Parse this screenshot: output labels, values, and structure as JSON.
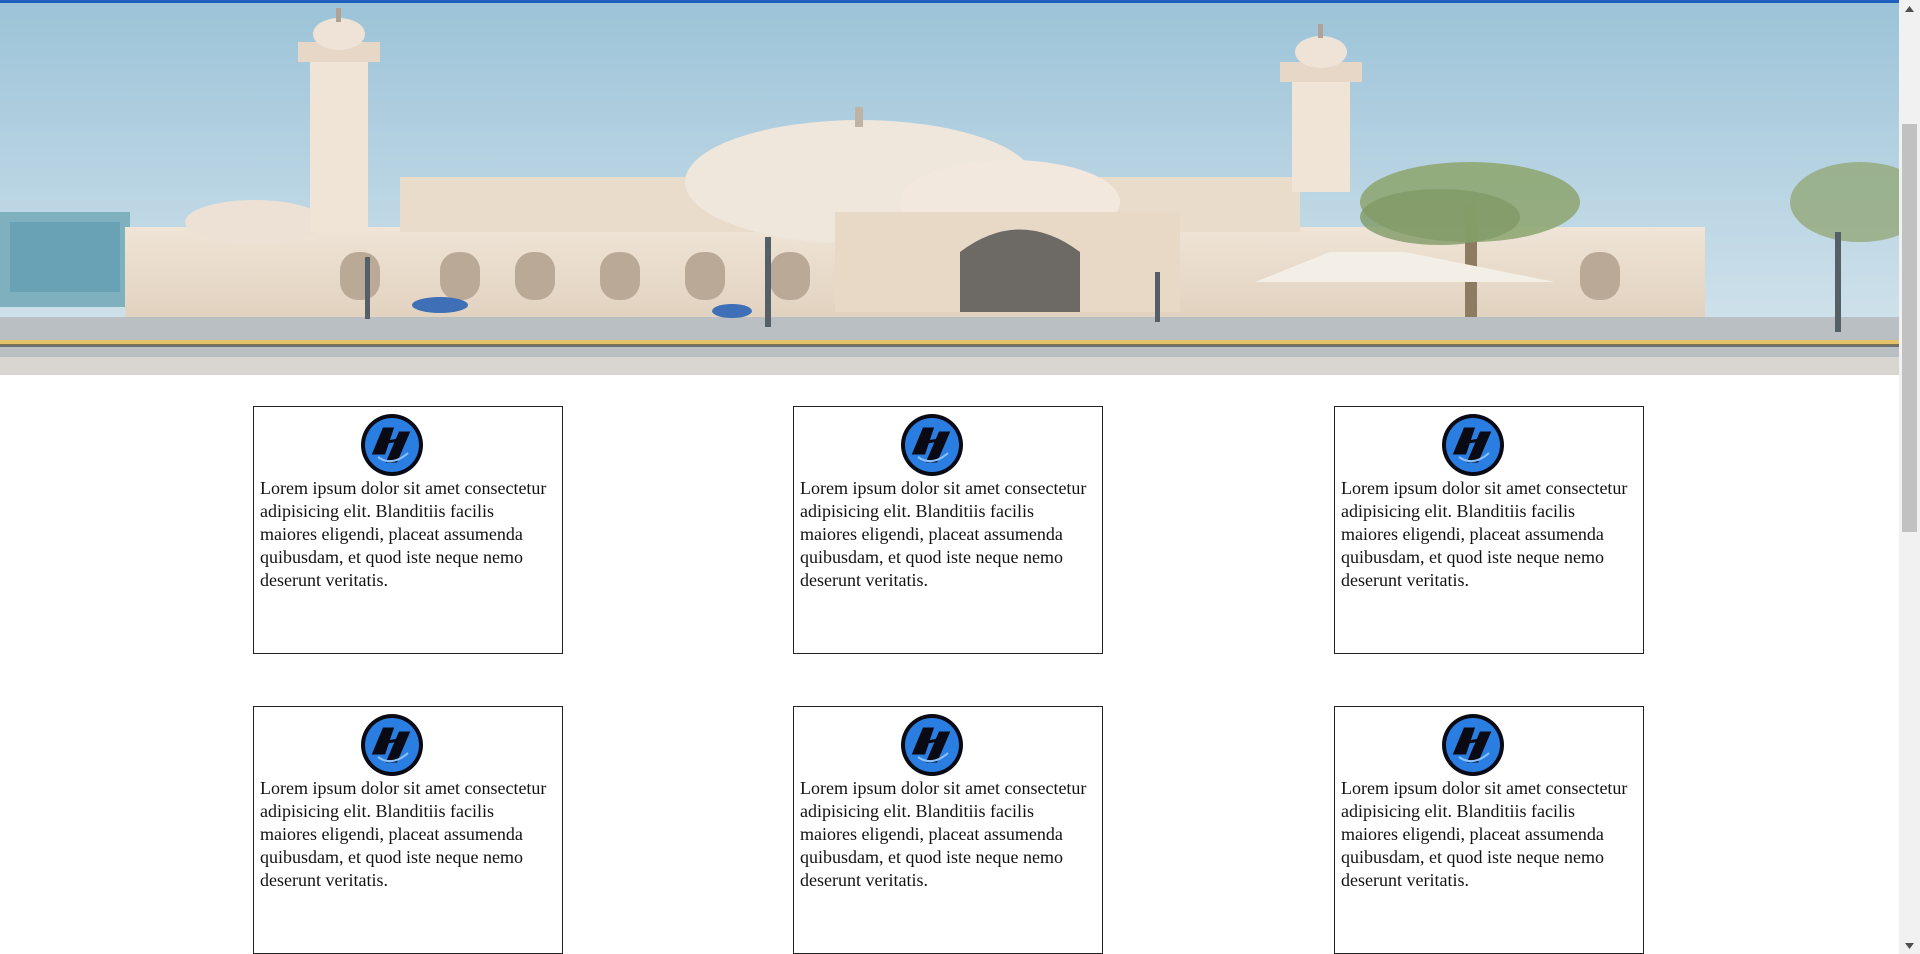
{
  "colors": {
    "top_accent": "#1f5fbf",
    "card_border": "#222222",
    "logo_blue": "#2a7de1",
    "logo_dark": "#0a0a14"
  },
  "hero": {
    "image": "mosque-photo",
    "description_icon": "banner-image"
  },
  "cards": [
    {
      "icon": "brand-logo-icon",
      "text": "Lorem ipsum dolor sit amet consectetur adipisicing elit. Blanditiis facilis maiores eligendi, placeat assumenda quibusdam, et quod iste neque nemo deserunt veritatis."
    },
    {
      "icon": "brand-logo-icon",
      "text": "Lorem ipsum dolor sit amet consectetur adipisicing elit. Blanditiis facilis maiores eligendi, placeat assumenda quibusdam, et quod iste neque nemo deserunt veritatis."
    },
    {
      "icon": "brand-logo-icon",
      "text": "Lorem ipsum dolor sit amet consectetur adipisicing elit. Blanditiis facilis maiores eligendi, placeat assumenda quibusdam, et quod iste neque nemo deserunt veritatis."
    },
    {
      "icon": "brand-logo-icon",
      "text": "Lorem ipsum dolor sit amet consectetur adipisicing elit. Blanditiis facilis maiores eligendi, placeat assumenda quibusdam, et quod iste neque nemo deserunt veritatis."
    },
    {
      "icon": "brand-logo-icon",
      "text": "Lorem ipsum dolor sit amet consectetur adipisicing elit. Blanditiis facilis maiores eligendi, placeat assumenda quibusdam, et quod iste neque nemo deserunt veritatis."
    },
    {
      "icon": "brand-logo-icon",
      "text": "Lorem ipsum dolor sit amet consectetur adipisicing elit. Blanditiis facilis maiores eligendi, placeat assumenda quibusdam, et quod iste neque nemo deserunt veritatis."
    }
  ],
  "scrollbar": {
    "up_icon": "scroll-up-arrow-icon",
    "down_icon": "scroll-down-arrow-icon"
  }
}
